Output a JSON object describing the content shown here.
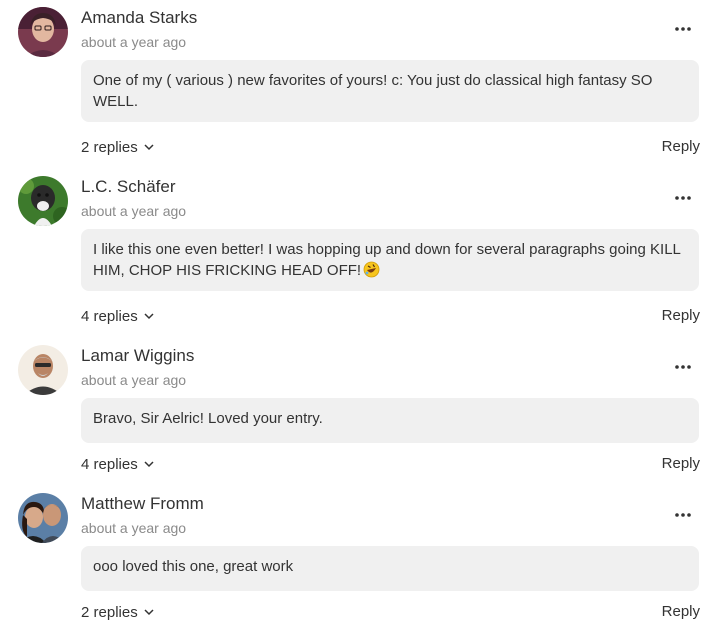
{
  "comments": [
    {
      "author": "Amanda Starks",
      "time": "about a year ago",
      "body": "One of my ( various ) new favorites of yours! c: You just do classical high fantasy SO WELL.",
      "replies_label": "2 replies",
      "reply_label": "Reply"
    },
    {
      "author": "L.C. Schäfer",
      "time": "about a year ago",
      "body": "I like this one even better! I was hopping up and down for several paragraphs going KILL HIM, CHOP HIS FRICKING HEAD OFF!",
      "replies_label": "4 replies",
      "reply_label": "Reply"
    },
    {
      "author": "Lamar Wiggins",
      "time": "about a year ago",
      "body": "Bravo, Sir Aelric! Loved your entry.",
      "replies_label": "4 replies",
      "reply_label": "Reply"
    },
    {
      "author": "Matthew Fromm",
      "time": "about a year ago",
      "body": "ooo loved this one, great work",
      "replies_label": "2 replies",
      "reply_label": "Reply"
    }
  ],
  "icons": {
    "more": "more-options-icon",
    "chevron": "chevron-down-icon",
    "emoji": "rolling-on-floor-laughing-emoji"
  },
  "colors": {
    "bubble_bg": "#f0f0f0",
    "timestamp": "#8a8a8a",
    "text": "#333333"
  }
}
